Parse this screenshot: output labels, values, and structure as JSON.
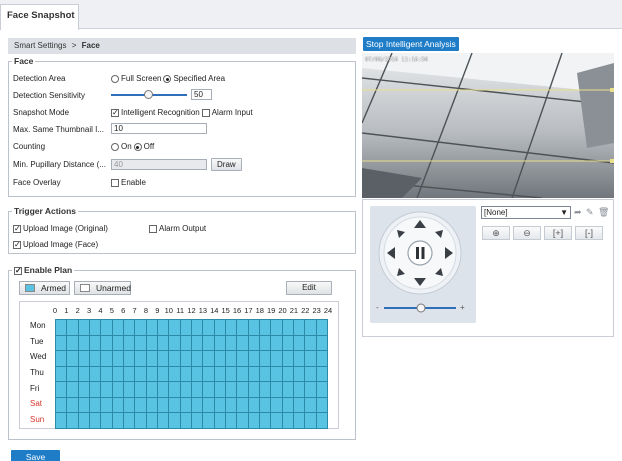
{
  "tab": {
    "title": "Face Snapshot"
  },
  "breadcrumb": {
    "parent": "Smart Settings",
    "separator": ">",
    "current": "Face"
  },
  "face": {
    "group_title": "Face",
    "detection_area": {
      "label": "Detection Area",
      "opt1": "Full Screen",
      "opt2": "Specified Area",
      "selected": "Specified Area"
    },
    "sensitivity": {
      "label": "Detection Sensitivity",
      "value": "50",
      "level_percent": 50
    },
    "snapshot_mode": {
      "label": "Snapshot Mode",
      "opt1": "Intelligent Recognition",
      "opt2": "Alarm Input",
      "opt1_checked": true,
      "opt2_checked": false
    },
    "max_thumbnail": {
      "label": "Max. Same Thumbnail I...",
      "value": "10"
    },
    "counting": {
      "label": "Counting",
      "on": "On",
      "off": "Off",
      "selected": "Off"
    },
    "pupillary": {
      "label": "Min. Pupillary Distance (...",
      "value": "40",
      "draw_label": "Draw"
    },
    "overlay": {
      "label": "Face Overlay",
      "enable": "Enable",
      "checked": false
    }
  },
  "trigger": {
    "group_title": "Trigger Actions",
    "upload_original": "Upload Image  (Original)",
    "alarm_output": "Alarm Output",
    "upload_face": "Upload Image  (Face)"
  },
  "plan": {
    "group_title": "Enable Plan",
    "armed": "Armed",
    "unarmed": "Unarmed",
    "edit": "Edit",
    "hours": [
      "0",
      "1",
      "2",
      "3",
      "4",
      "5",
      "6",
      "7",
      "8",
      "9",
      "10",
      "11",
      "12",
      "13",
      "14",
      "15",
      "16",
      "17",
      "18",
      "19",
      "20",
      "21",
      "22",
      "23",
      "24"
    ],
    "days": [
      "Mon",
      "Tue",
      "Wed",
      "Thu",
      "Fri",
      "Sat",
      "Sun"
    ],
    "armed_color": "#59c3e3",
    "weekend_color": "#d9342b"
  },
  "save": {
    "label": "Save"
  },
  "video": {
    "stop_label": "Stop Intelligent Analysis",
    "timestamp": "07/08/2016 11:16:50"
  },
  "ptz": {
    "preset_value": "[None]",
    "icons": [
      "goto-preset-icon",
      "edit-preset-icon",
      "delete-preset-icon"
    ],
    "zoom_buttons": [
      "zoom-in-icon",
      "zoom-out-icon",
      "focus-near-icon",
      "focus-far-icon"
    ],
    "speed_minus": "-",
    "speed_plus": "+"
  }
}
